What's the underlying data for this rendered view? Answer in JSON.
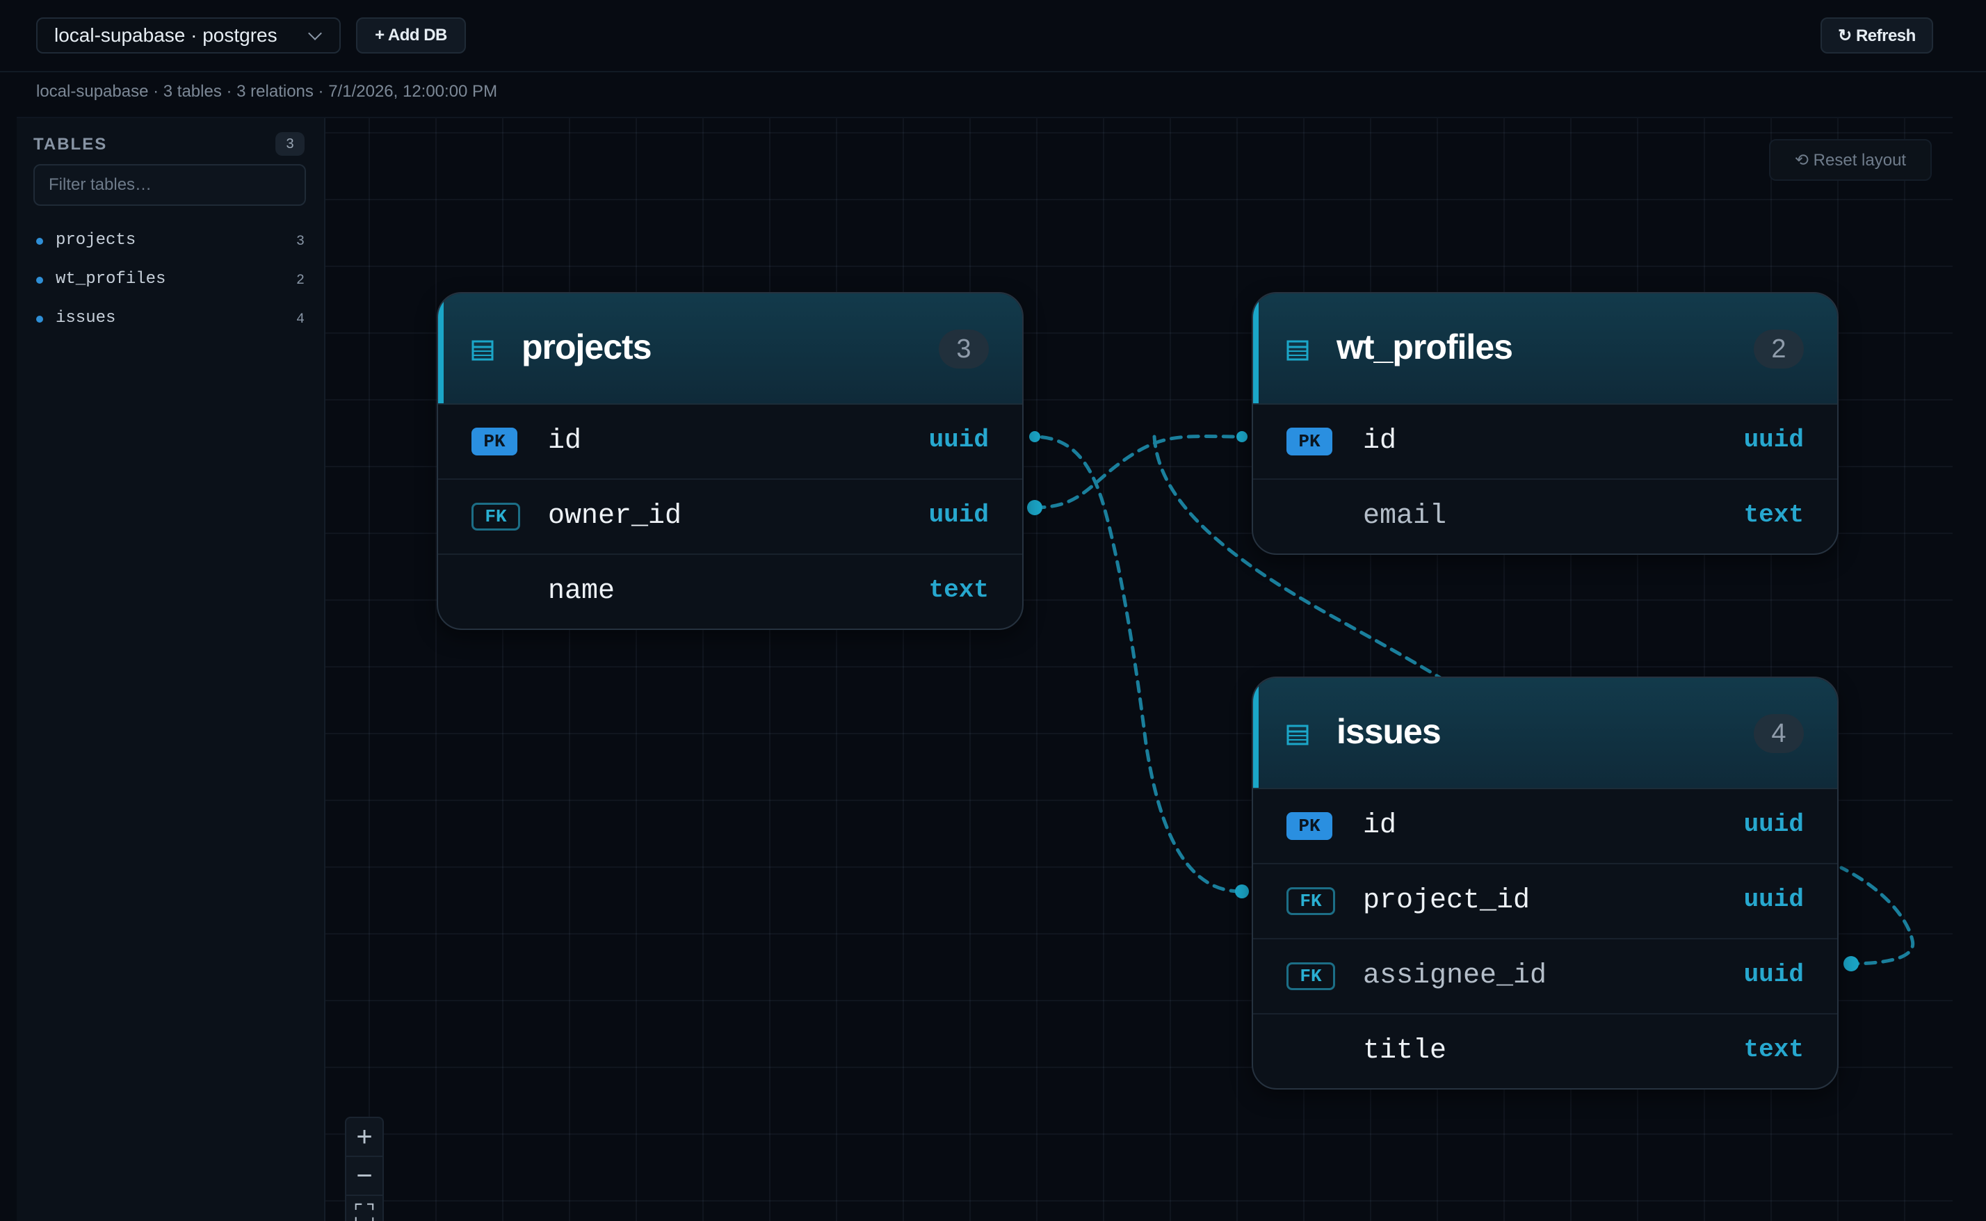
{
  "toolbar": {
    "db_selector": "local-supabase · postgres",
    "add_db_label": "+ Add DB",
    "refresh_label": "↻ Refresh"
  },
  "status_line": "local-supabase · 3 tables · 3 relations · 7/1/2026, 12:00:00 PM",
  "sidebar": {
    "title": "TABLES",
    "count": "3",
    "filter_placeholder": "Filter tables…",
    "tables": [
      {
        "name": "projects",
        "count": "3"
      },
      {
        "name": "wt_profiles",
        "count": "2"
      },
      {
        "name": "issues",
        "count": "4"
      }
    ]
  },
  "canvas": {
    "reset_layout_label": "⟲ Reset layout",
    "zoom": {
      "in": "+",
      "out": "−",
      "fit": "⛶"
    }
  },
  "tables": {
    "projects": {
      "name": "projects",
      "count": "3",
      "columns": [
        {
          "badge": "PK",
          "name": "id",
          "type": "uuid"
        },
        {
          "badge": "FK",
          "name": "owner_id",
          "type": "uuid"
        },
        {
          "badge": "",
          "name": "name",
          "type": "text"
        }
      ]
    },
    "wt_profiles": {
      "name": "wt_profiles",
      "count": "2",
      "columns": [
        {
          "badge": "PK",
          "name": "id",
          "type": "uuid"
        },
        {
          "badge": "",
          "name": "email",
          "type": "text"
        }
      ]
    },
    "issues": {
      "name": "issues",
      "count": "4",
      "columns": [
        {
          "badge": "PK",
          "name": "id",
          "type": "uuid"
        },
        {
          "badge": "FK",
          "name": "project_id",
          "type": "uuid"
        },
        {
          "badge": "FK",
          "name": "assignee_id",
          "type": "uuid"
        },
        {
          "badge": "",
          "name": "title",
          "type": "text"
        }
      ]
    }
  },
  "colors": {
    "accent": "#1ba6c8",
    "edge": "#1a7f9c",
    "pk_badge": "#2a8fe0",
    "type_text": "#27a8cf"
  }
}
